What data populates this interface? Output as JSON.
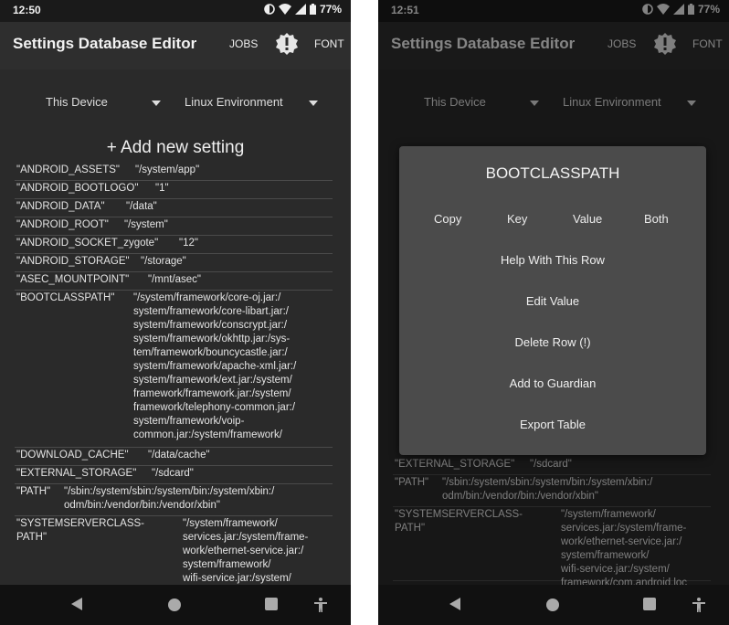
{
  "status": {
    "time_left": "12:50",
    "time_right": "12:51",
    "battery": "77%"
  },
  "appbar": {
    "title": "Settings Database Editor",
    "jobs": "JOBS",
    "font": "FONT"
  },
  "spinners": {
    "device": "This Device",
    "environment": "Linux Environment"
  },
  "add_new": "+ Add new setting",
  "rows": [
    {
      "key": "\"ANDROID_ASSETS\"",
      "value": "\"/system/app\""
    },
    {
      "key": "\"ANDROID_BOOTLOGO\"",
      "value": "\"1\""
    },
    {
      "key": "\"ANDROID_DATA\"",
      "value": "\"/data\""
    },
    {
      "key": "\"ANDROID_ROOT\"",
      "value": "\"/system\""
    },
    {
      "key": "\"ANDROID_SOCKET_zygote\"",
      "value": "\"12\""
    },
    {
      "key": "\"ANDROID_STORAGE\"",
      "value": "\"/storage\""
    },
    {
      "key": "\"ASEC_MOUNTPOINT\"",
      "value": "\"/mnt/asec\""
    },
    {
      "key": "\"BOOTCLASSPATH\"",
      "value": "\"/system/framework/core-oj.jar:/\nsystem/framework/core-libart.jar:/\nsystem/framework/conscrypt.jar:/\nsystem/framework/okhttp.jar:/sys-\ntem/framework/bouncycastle.jar:/\nsystem/framework/apache-xml.jar:/\nsystem/framework/ext.jar:/system/\nframework/framework.jar:/system/\nframework/telephony-common.jar:/\nsystem/framework/voip-\ncommon.jar:/system/framework/"
    },
    {
      "key": "\"DOWNLOAD_CACHE\"",
      "value": "\"/data/cache\""
    },
    {
      "key": "\"EXTERNAL_STORAGE\"",
      "value": "\"/sdcard\""
    },
    {
      "key": "\"PATH\"",
      "value": "\"/sbin:/system/sbin:/system/bin:/system/xbin:/\nodm/bin:/vendor/bin:/vendor/xbin\""
    },
    {
      "key": "\"SYSTEMSERVERCLASS-\nPATH\"",
      "value": "\"/system/framework/\nservices.jar:/system/frame-\nwork/ethernet-service.jar:/\nsystem/framework/\nwifi-service.jar:/system/\nframework/com.android.loc"
    }
  ],
  "right_rows": [
    {
      "key": "\"EXTERNAL_STORAGE\"",
      "value": "\"/sdcard\""
    },
    {
      "key": "\"PATH\"",
      "value": "\"/sbin:/system/sbin:/system/bin:/system/xbin:/\nodm/bin:/vendor/bin:/vendor/xbin\""
    },
    {
      "key": "\"SYSTEMSERVERCLASS-\nPATH\"",
      "value": "\"/system/framework/\nservices.jar:/system/frame-\nwork/ethernet-service.jar:/\nsystem/framework/\nwifi-service.jar:/system/\nframework/com.android.loc"
    }
  ],
  "dialog": {
    "title": "BOOTCLASSPATH",
    "copy": "Copy",
    "key": "Key",
    "value": "Value",
    "both": "Both",
    "actions": [
      "Help With This Row",
      "Edit Value",
      "Delete Row (!)",
      "Add to Guardian",
      "Export Table"
    ]
  },
  "colors": {
    "background": "#2a2a2a",
    "dialog": "#4b4b4b",
    "navbar": "#111111"
  }
}
